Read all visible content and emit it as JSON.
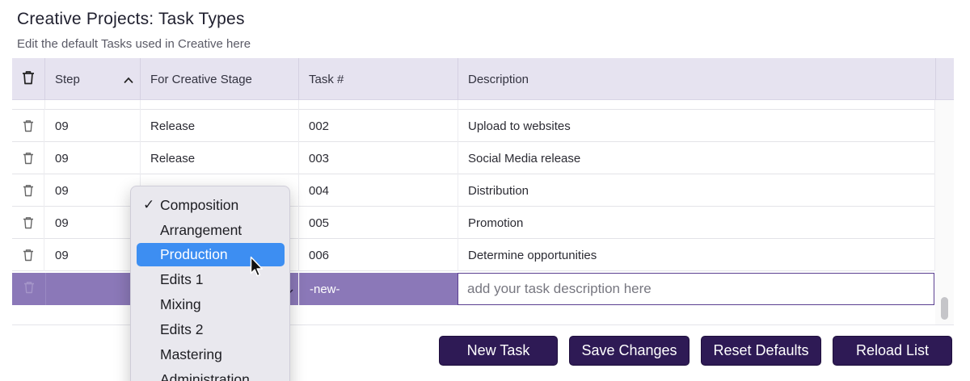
{
  "header": {
    "title": "Creative Projects: Task Types",
    "subtitle": "Edit the default Tasks used in Creative here"
  },
  "grid": {
    "columns": {
      "step": "Step",
      "stage": "For Creative Stage",
      "task": "Task #",
      "description": "Description"
    },
    "rows": [
      {
        "step": "09",
        "stage": "Release",
        "task": "002",
        "description": "Upload to websites"
      },
      {
        "step": "09",
        "stage": "Release",
        "task": "003",
        "description": "Social Media release"
      },
      {
        "step": "09",
        "stage": "",
        "task": "004",
        "description": "Distribution"
      },
      {
        "step": "09",
        "stage": "",
        "task": "005",
        "description": "Promotion"
      },
      {
        "step": "09",
        "stage": "",
        "task": "006",
        "description": "Determine opportunities"
      }
    ],
    "new_row": {
      "task": "-new-",
      "description_placeholder": "add your task description here"
    }
  },
  "dropdown": {
    "selected": "Composition",
    "highlighted": "Production",
    "options": [
      "Composition",
      "Arrangement",
      "Production",
      "Edits 1",
      "Mixing",
      "Edits 2",
      "Mastering",
      "Administration"
    ]
  },
  "buttons": {
    "new_task": "New Task",
    "save_changes": "Save Changes",
    "reset_defaults": "Reset Defaults",
    "reload_list": "Reload List"
  },
  "colors": {
    "header_bg": "#e6e3f0",
    "new_row_bg": "#8b78b8",
    "button_bg": "#2e1a55",
    "highlight": "#3d8ef2"
  },
  "icons": {
    "delete": "trash-icon",
    "sort": "chevron-up-icon",
    "select_caret": "chevron-down-icon",
    "selected_mark": "checkmark-icon",
    "pointer": "mouse-cursor-icon"
  }
}
